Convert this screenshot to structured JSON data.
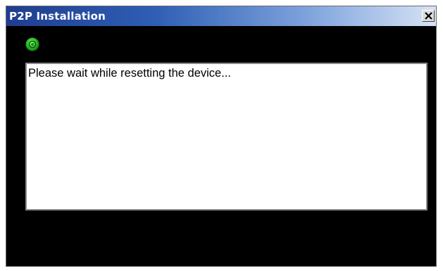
{
  "window": {
    "title": "P2P Installation",
    "close_glyph": "×"
  },
  "status": {
    "icon": "green-status-light-icon",
    "color": "#2ecc40"
  },
  "message": {
    "text": "Please wait while resetting the device..."
  },
  "colors": {
    "titlebar_start": "#1f3d8f",
    "titlebar_end": "#d6e2f5",
    "window_background": "#000000",
    "message_background": "#ffffff"
  }
}
